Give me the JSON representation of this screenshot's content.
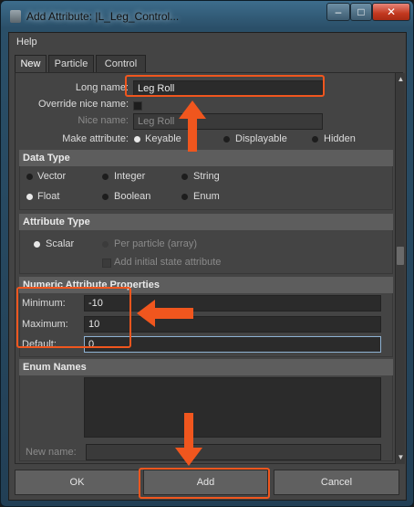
{
  "window": {
    "title": "Add Attribute: |L_Leg_Control...",
    "minimize_glyph": "–",
    "maximize_glyph": "□",
    "close_glyph": "✕"
  },
  "menu": {
    "help": "Help"
  },
  "tabs": [
    {
      "label": "New",
      "active": true
    },
    {
      "label": "Particle",
      "active": false
    },
    {
      "label": "Control",
      "active": false
    }
  ],
  "form": {
    "long_name_label": "Long name:",
    "long_name_value": "Leg Roll",
    "override_nice_name_label": "Override nice name:",
    "nice_name_label": "Nice name:",
    "nice_name_value": "Leg Roll",
    "make_attribute_label": "Make attribute:",
    "make_attribute_options": [
      "Keyable",
      "Displayable",
      "Hidden"
    ],
    "make_attribute_selected": "Keyable"
  },
  "data_type": {
    "header": "Data Type",
    "options": [
      "Vector",
      "Integer",
      "String",
      "Float",
      "Boolean",
      "Enum"
    ],
    "selected": "Float"
  },
  "attribute_type": {
    "header": "Attribute Type",
    "scalar": "Scalar",
    "per_particle": "Per particle (array)",
    "add_initial_state": "Add initial state attribute",
    "selected": "Scalar"
  },
  "numeric": {
    "header": "Numeric Attribute Properties",
    "minimum_label": "Minimum:",
    "minimum_value": "-10",
    "maximum_label": "Maximum:",
    "maximum_value": "10",
    "default_label": "Default:",
    "default_value": "0"
  },
  "enum": {
    "header": "Enum Names",
    "new_name_label": "New name:"
  },
  "buttons": {
    "ok": "OK",
    "add": "Add",
    "cancel": "Cancel"
  },
  "colors": {
    "annotation": "#f0561e",
    "background": "#444444",
    "field": "#2b2b2b"
  },
  "annotation_icons": [
    "arrow-up-icon",
    "arrow-left-icon",
    "arrow-down-icon"
  ]
}
